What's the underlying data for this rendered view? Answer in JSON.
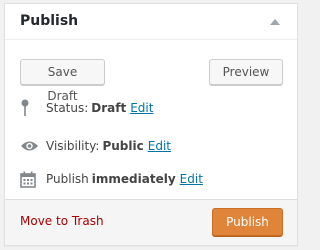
{
  "panel": {
    "title": "Publish"
  },
  "actions": {
    "save_draft_label": "Save Draft",
    "preview_label": "Preview"
  },
  "status": {
    "label": "Status:",
    "value": "Draft",
    "edit_label": "Edit",
    "icon": "pin-icon"
  },
  "visibility": {
    "label": "Visibility:",
    "value": "Public",
    "edit_label": "Edit",
    "icon": "eye-icon"
  },
  "schedule": {
    "label": "Publish",
    "value": "immediately",
    "edit_label": "Edit",
    "icon": "calendar-icon"
  },
  "footer": {
    "trash_label": "Move to Trash",
    "publish_label": "Publish"
  },
  "colors": {
    "link": "#0073aa",
    "trash": "#aa0000",
    "publish_button": "#e0843a"
  }
}
